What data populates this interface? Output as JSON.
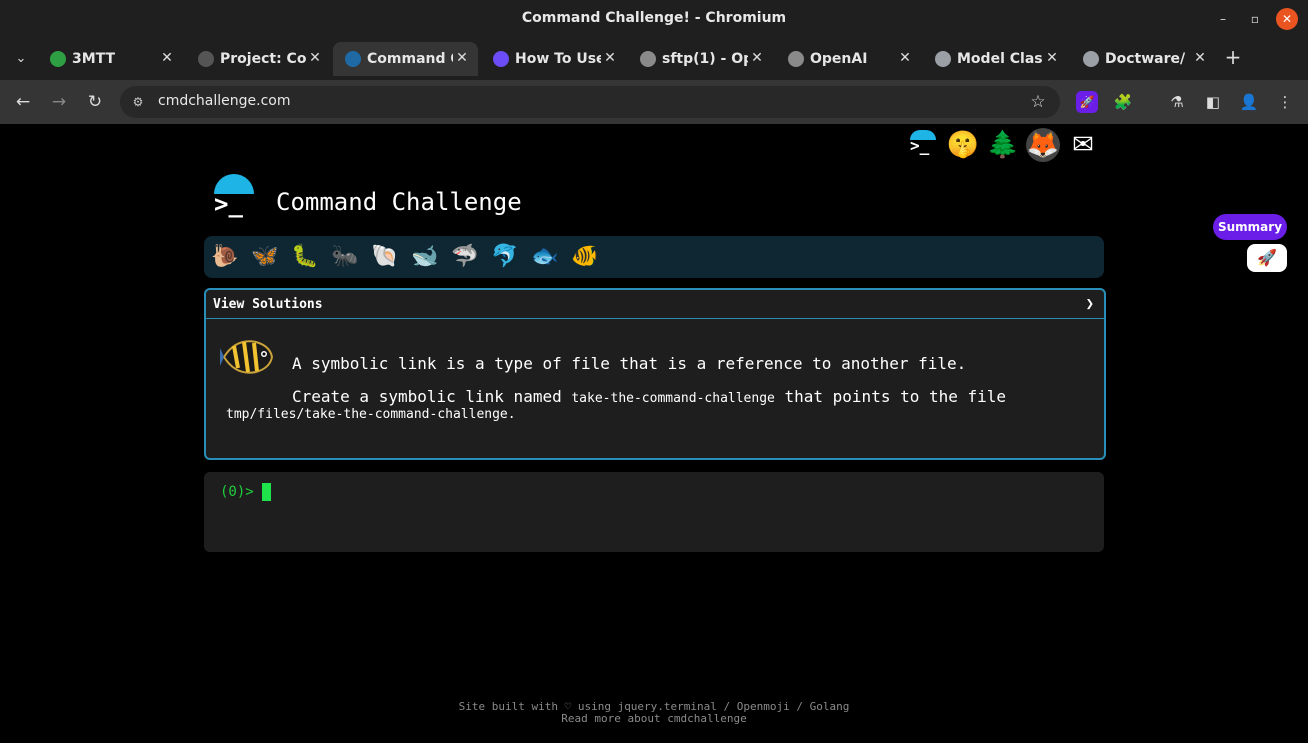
{
  "window": {
    "title": "Command Challenge! - Chromium",
    "minimize_glyph": "–",
    "maximize_glyph": "▫",
    "close_glyph": "✕"
  },
  "tabs": [
    {
      "label": "3MTT",
      "icon_color": "#2ea043",
      "close": "✕"
    },
    {
      "label": "Project: Co",
      "icon_color": "#555555",
      "close": "✕"
    },
    {
      "label": "Command C",
      "icon_color": "#1f6aa5",
      "close": "✕"
    },
    {
      "label": "How To Use",
      "icon_color": "#6b4cf6",
      "close": "✕"
    },
    {
      "label": "sftp(1) - Op",
      "icon_color": "#8a8a8a",
      "close": "✕"
    },
    {
      "label": "OpenAI",
      "icon_color": "#8a8a8a",
      "close": "✕"
    },
    {
      "label": "Model Clas",
      "icon_color": "#9aa0a6",
      "close": "✕"
    },
    {
      "label": "Doctware/",
      "icon_color": "#9aa0a6",
      "close": "✕"
    }
  ],
  "tab_strip": {
    "chevron": "⌄",
    "new_tab": "+"
  },
  "toolbar": {
    "back": "←",
    "forward": "→",
    "reload": "↻",
    "url": "cmdchallenge.com",
    "site_info_glyph": "⚙",
    "bookmark_glyph": "☆",
    "extension_glyph": "🧩",
    "labs_glyph": "⚗",
    "sidepanel_glyph": "◧",
    "profile_glyph": "👤",
    "menu_glyph": "⋮",
    "rocket_glyph": "🚀"
  },
  "page": {
    "top_icons": [
      {
        "name": "terminal-logo-icon",
        "glyph": ">_"
      },
      {
        "name": "shushing-face-icon",
        "glyph": "🤫"
      },
      {
        "name": "tree-icon",
        "glyph": "🌲"
      },
      {
        "name": "gitlab-icon",
        "glyph": "🦊"
      },
      {
        "name": "mail-icon",
        "glyph": "✉"
      }
    ],
    "logo_prompt": ">_",
    "brand": "Command Challenge",
    "levels": [
      {
        "name": "snail-icon",
        "glyph": "🐌"
      },
      {
        "name": "butterfly-icon",
        "glyph": "🦋"
      },
      {
        "name": "caterpillar-icon",
        "glyph": "🐛"
      },
      {
        "name": "ant-icon",
        "glyph": "🐜"
      },
      {
        "name": "shell-icon",
        "glyph": "🐚"
      },
      {
        "name": "whale-icon",
        "glyph": "🐋"
      },
      {
        "name": "shark-icon",
        "glyph": "🦈"
      },
      {
        "name": "dolphin-icon",
        "glyph": "🐬"
      },
      {
        "name": "fish-icon",
        "glyph": "🐟"
      },
      {
        "name": "tropical-fish-icon",
        "glyph": "🐠"
      }
    ],
    "panel": {
      "header": "View Solutions",
      "chevron": "❯",
      "line1": "A symbolic link is a type of file that is a reference to another file.",
      "line2_pre": "Create a symbolic link named ",
      "line2_code": "take-the-command-challenge",
      "line2_post": " that points to the file",
      "line3": "tmp/files/take-the-command-challenge."
    },
    "terminal": {
      "prompt": "(0)>"
    },
    "footer": {
      "line1": "Site built with ♡ using jquery.terminal / Openmoji / Golang",
      "line2": "Read more about cmdchallenge"
    }
  },
  "summary": {
    "label": "Summary",
    "icon_glyph": "🚀"
  },
  "colors": {
    "accent": "#2a8fb8",
    "prompt_green": "#1fd13b",
    "summary_purple": "#6a1ee8"
  }
}
